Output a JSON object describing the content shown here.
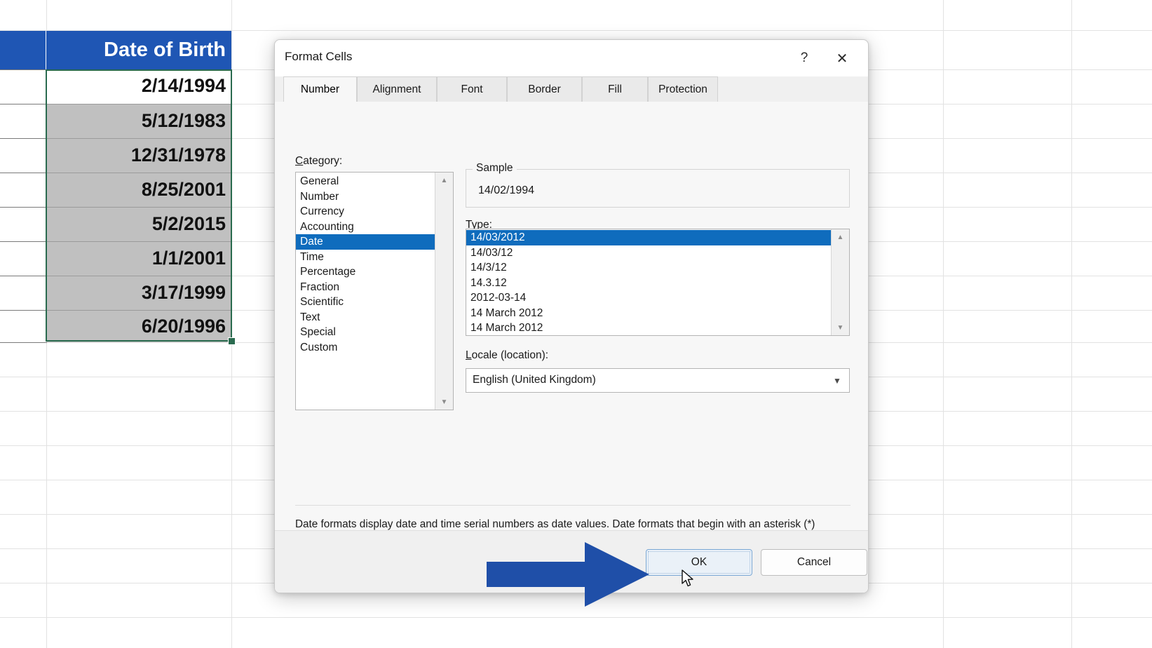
{
  "spreadsheet": {
    "column_header": "Date of Birth",
    "cells": [
      {
        "value": "2/14/1994",
        "state": "active"
      },
      {
        "value": "5/12/1983",
        "state": "selected"
      },
      {
        "value": "12/31/1978",
        "state": "selected"
      },
      {
        "value": "8/25/2001",
        "state": "selected"
      },
      {
        "value": "5/2/2015",
        "state": "selected"
      },
      {
        "value": "1/1/2001",
        "state": "selected"
      },
      {
        "value": "3/17/1999",
        "state": "selected"
      },
      {
        "value": "6/20/1996",
        "state": "selected"
      }
    ],
    "header_color": "#1f56b4",
    "selection_border_color": "#2a6b4f",
    "selected_fill": "#c0c0c0"
  },
  "dialog": {
    "title": "Format Cells",
    "help_icon": "?",
    "close_icon": "✕",
    "tabs": [
      {
        "label": "Number",
        "active": true
      },
      {
        "label": "Alignment",
        "active": false
      },
      {
        "label": "Font",
        "active": false
      },
      {
        "label": "Border",
        "active": false
      },
      {
        "label": "Fill",
        "active": false
      },
      {
        "label": "Protection",
        "active": false
      }
    ],
    "category": {
      "label": "Category:",
      "label_accel": "C",
      "items": [
        "General",
        "Number",
        "Currency",
        "Accounting",
        "Date",
        "Time",
        "Percentage",
        "Fraction",
        "Scientific",
        "Text",
        "Special",
        "Custom"
      ],
      "selected": "Date"
    },
    "sample": {
      "legend": "Sample",
      "value": "14/02/1994"
    },
    "type": {
      "label": "Type:",
      "label_accel": "T",
      "items": [
        "14/03/2012",
        "14/03/12",
        "14/3/12",
        "14.3.12",
        "2012-03-14",
        "14 March 2012",
        "14 March 2012"
      ],
      "selected": "14/03/2012"
    },
    "locale": {
      "label": "Locale (location):",
      "label_accel": "L",
      "value": "English (United Kingdom)",
      "chevron": "▼"
    },
    "description": "Date formats display date and time serial numbers as date values.  Date formats that begin with an asterisk (*) respond to changes in regional date and time settings that are specified for the operating system. Formats without an asterisk are not affected by operating system settings.",
    "buttons": {
      "ok": "OK",
      "cancel": "Cancel"
    },
    "scroll_up_icon": "▲",
    "scroll_down_icon": "▼"
  },
  "annotation": {
    "arrow_color": "#1f4fa8",
    "arrow_direction": "right"
  }
}
